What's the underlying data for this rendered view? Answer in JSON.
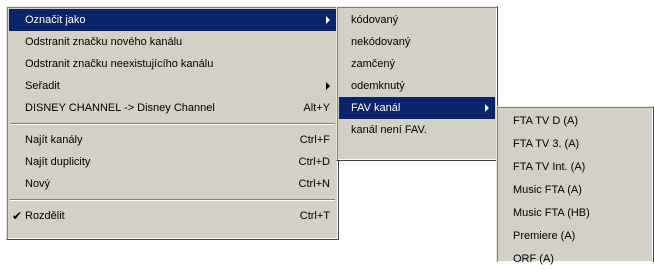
{
  "main_menu": {
    "items": [
      {
        "label": "Označit jako",
        "shortcut": "",
        "submenu": true,
        "selected": true
      },
      {
        "label": "Odstranit značku nového kanálu",
        "shortcut": ""
      },
      {
        "label": "Odstranit značku neexistujícího kanálu",
        "shortcut": ""
      },
      {
        "label": "Seřadit",
        "shortcut": "",
        "submenu": true
      },
      {
        "label": "DISNEY CHANNEL -> Disney Channel",
        "shortcut": "Alt+Y"
      },
      {
        "label": "Najít kanály",
        "shortcut": "Ctrl+F"
      },
      {
        "label": "Najít duplicity",
        "shortcut": "Ctrl+D"
      },
      {
        "label": "Nový",
        "shortcut": "Ctrl+N"
      },
      {
        "label": "Rozdělit",
        "shortcut": "Ctrl+T",
        "checked": true
      }
    ],
    "check_glyph": "✔"
  },
  "mark_as_submenu": {
    "items": [
      {
        "label": "kódovaný"
      },
      {
        "label": "nekódovaný"
      },
      {
        "label": "zamčený"
      },
      {
        "label": "odemknutý"
      },
      {
        "label": "FAV kanál",
        "submenu": true,
        "selected": true
      },
      {
        "label": "kanál není FAV."
      }
    ]
  },
  "fav_submenu": {
    "items": [
      {
        "label": "FTA TV D (A)"
      },
      {
        "label": "FTA TV 3. (A)"
      },
      {
        "label": "FTA TV Int. (A)"
      },
      {
        "label": "Music FTA (A)"
      },
      {
        "label": "Music FTA (HB)"
      },
      {
        "label": "Premiere (A)"
      },
      {
        "label": "ORF (A)"
      }
    ]
  },
  "colors": {
    "menu_bg": "#d4d0c8",
    "highlight_bg": "#0a246a",
    "highlight_text": "#ffffff"
  },
  "icons": {
    "submenu_arrow": "triangle-right",
    "check": "check-mark"
  }
}
